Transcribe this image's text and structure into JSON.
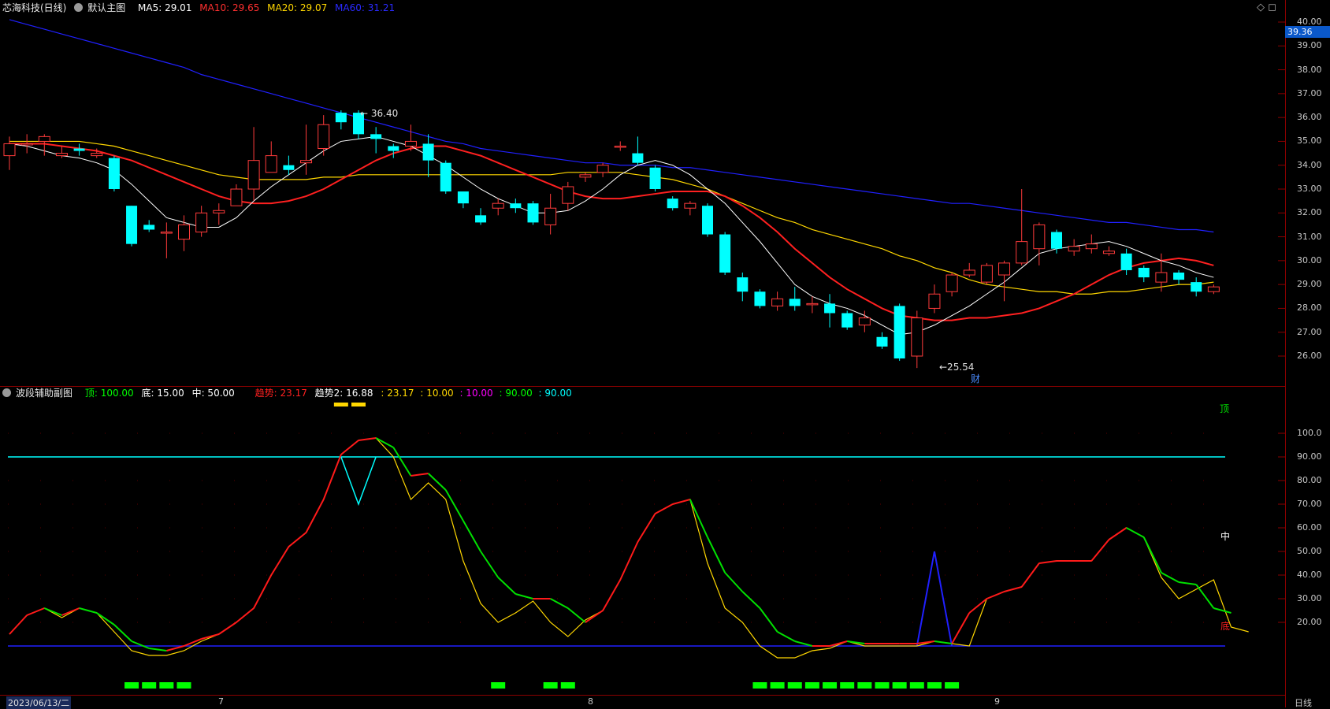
{
  "main_legend": {
    "stock_name": "芯海科技(日线)",
    "chart_name": "默认主图",
    "ma5": "MA5: 29.01",
    "ma10": "MA10: 29.65",
    "ma20": "MA20: 29.07",
    "ma60": "MA60: 31.21"
  },
  "sub_legend": {
    "chart_name": "波段辅助副图",
    "top": "顶: 100.00",
    "bottom": "底: 15.00",
    "mid": "中: 50.00",
    "trend": "趋势: 23.17",
    "trend2": "趋势2: 16.88",
    "v1": ": 23.17",
    "v2": ": 10.00",
    "v3": ": 10.00",
    "v4": ": 90.00",
    "v5": ": 90.00"
  },
  "last_price": "39.36",
  "high_label": "← 36.40",
  "low_label": "←25.54",
  "finance_marker": "财",
  "cycle_top": "顶",
  "cycle_mid": "中",
  "cycle_bottom": "底",
  "start_date": "2023/06/13/二",
  "period": "日线",
  "corner_icons": "◇ ◻",
  "x_month_labels": [
    "7",
    "8",
    "9"
  ],
  "y_ticks_main": [
    "40.00",
    "39.00",
    "38.00",
    "37.00",
    "36.00",
    "35.00",
    "34.00",
    "33.00",
    "32.00",
    "31.00",
    "30.00",
    "29.00",
    "28.00",
    "27.00",
    "26.00"
  ],
  "y_ticks_sub": [
    "100.0",
    "90.00",
    "80.00",
    "70.00",
    "60.00",
    "50.00",
    "40.00",
    "30.00",
    "20.00"
  ],
  "colors": {
    "up": "#ff3b3b",
    "down": "#00ffff",
    "ma5": "#ffffff",
    "ma10": "#ff2020",
    "ma20": "#ffd700",
    "ma60": "#2020ff",
    "signal": "#00ff00"
  },
  "chart_data": [
    {
      "type": "candlestick",
      "title": "芯海科技(日线)",
      "ylim": [
        25.5,
        40.0
      ],
      "candles": [
        [
          34.4,
          34.9,
          33.8,
          35.2
        ],
        [
          34.9,
          34.9,
          34.5,
          35.3
        ],
        [
          35.0,
          35.2,
          34.4,
          35.3
        ],
        [
          34.4,
          34.5,
          34.3,
          34.8
        ],
        [
          34.7,
          34.6,
          34.4,
          34.9
        ],
        [
          34.4,
          34.5,
          34.3,
          34.7
        ],
        [
          34.3,
          33.0,
          32.9,
          34.4
        ],
        [
          32.3,
          30.7,
          30.6,
          32.3
        ],
        [
          31.5,
          31.3,
          31.2,
          31.7
        ],
        [
          31.2,
          31.2,
          30.1,
          31.6
        ],
        [
          30.9,
          31.5,
          30.4,
          31.9
        ],
        [
          31.2,
          32.0,
          31.0,
          32.3
        ],
        [
          32.0,
          32.1,
          31.5,
          32.4
        ],
        [
          32.3,
          33.0,
          32.3,
          33.2
        ],
        [
          33.0,
          34.2,
          32.5,
          35.6
        ],
        [
          33.7,
          34.4,
          33.7,
          35.0
        ],
        [
          34.0,
          33.8,
          33.6,
          34.4
        ],
        [
          34.1,
          34.2,
          33.6,
          35.7
        ],
        [
          34.7,
          35.7,
          34.4,
          36.1
        ],
        [
          36.2,
          35.8,
          35.5,
          36.3
        ],
        [
          36.2,
          35.3,
          35.1,
          36.3
        ],
        [
          35.3,
          35.1,
          34.5,
          35.6
        ],
        [
          34.8,
          34.6,
          34.3,
          34.9
        ],
        [
          34.8,
          35.0,
          34.6,
          35.7
        ],
        [
          34.9,
          34.2,
          33.5,
          35.3
        ],
        [
          34.1,
          32.9,
          32.8,
          34.2
        ],
        [
          32.9,
          32.4,
          32.2,
          32.9
        ],
        [
          31.9,
          31.6,
          31.5,
          32.2
        ],
        [
          32.2,
          32.4,
          31.9,
          32.6
        ],
        [
          32.4,
          32.2,
          32.0,
          32.6
        ],
        [
          32.4,
          31.6,
          31.5,
          32.5
        ],
        [
          31.5,
          32.2,
          31.1,
          32.8
        ],
        [
          32.4,
          33.1,
          32.1,
          33.3
        ],
        [
          33.5,
          33.6,
          33.3,
          33.7
        ],
        [
          33.7,
          34.0,
          33.5,
          34.1
        ],
        [
          34.8,
          34.8,
          34.6,
          35.0
        ],
        [
          34.5,
          34.1,
          34.0,
          35.2
        ],
        [
          33.9,
          33.0,
          32.9,
          34.0
        ],
        [
          32.6,
          32.2,
          32.1,
          32.7
        ],
        [
          32.2,
          32.4,
          31.9,
          32.5
        ],
        [
          32.3,
          31.1,
          31.0,
          32.4
        ],
        [
          31.1,
          29.5,
          29.4,
          31.2
        ],
        [
          29.3,
          28.7,
          28.3,
          29.5
        ],
        [
          28.7,
          28.1,
          28.0,
          28.8
        ],
        [
          28.1,
          28.4,
          27.9,
          28.7
        ],
        [
          28.4,
          28.1,
          27.9,
          28.9
        ],
        [
          28.2,
          28.2,
          27.8,
          28.5
        ],
        [
          28.2,
          27.8,
          27.2,
          28.6
        ],
        [
          27.8,
          27.2,
          27.1,
          27.9
        ],
        [
          27.3,
          27.6,
          27.0,
          27.9
        ],
        [
          26.8,
          26.4,
          26.3,
          27.0
        ],
        [
          28.1,
          25.9,
          25.8,
          28.2
        ],
        [
          26.0,
          27.6,
          25.5,
          27.9
        ],
        [
          28.0,
          28.6,
          27.8,
          29.0
        ],
        [
          28.7,
          29.4,
          28.5,
          29.5
        ],
        [
          29.4,
          29.6,
          29.3,
          29.9
        ],
        [
          29.1,
          29.8,
          29.0,
          29.9
        ],
        [
          29.4,
          29.9,
          28.3,
          30.0
        ],
        [
          29.9,
          30.8,
          29.8,
          33.0
        ],
        [
          30.5,
          31.5,
          29.8,
          31.6
        ],
        [
          31.2,
          30.5,
          30.3,
          31.3
        ],
        [
          30.4,
          30.6,
          30.2,
          30.9
        ],
        [
          30.5,
          30.7,
          30.3,
          31.1
        ],
        [
          30.3,
          30.4,
          30.2,
          30.6
        ],
        [
          30.3,
          29.6,
          29.4,
          30.5
        ],
        [
          29.7,
          29.3,
          29.1,
          29.8
        ],
        [
          29.1,
          29.5,
          28.7,
          30.3
        ],
        [
          29.5,
          29.2,
          29.0,
          29.6
        ],
        [
          29.1,
          28.7,
          28.5,
          29.3
        ],
        [
          28.7,
          28.9,
          28.6,
          29.0
        ]
      ],
      "ma5": [
        34.9,
        34.8,
        34.6,
        34.4,
        34.3,
        34.1,
        33.8,
        33.2,
        32.5,
        31.8,
        31.6,
        31.4,
        31.4,
        31.8,
        32.5,
        33.1,
        33.6,
        34.1,
        34.6,
        35.0,
        35.1,
        35.2,
        35.0,
        34.8,
        34.4,
        34.0,
        33.5,
        33.0,
        32.6,
        32.3,
        32.0,
        32.0,
        32.1,
        32.5,
        33.0,
        33.6,
        34.0,
        34.2,
        34.0,
        33.6,
        33.0,
        32.4,
        31.6,
        30.8,
        29.9,
        29.0,
        28.5,
        28.2,
        28.0,
        27.7,
        27.3,
        26.9,
        27.0,
        27.3,
        27.7,
        28.1,
        28.6,
        29.1,
        29.7,
        30.3,
        30.5,
        30.6,
        30.7,
        30.8,
        30.6,
        30.3,
        30.0,
        29.8,
        29.5,
        29.3
      ],
      "ma10": [
        34.9,
        34.9,
        34.9,
        34.8,
        34.7,
        34.6,
        34.4,
        34.2,
        33.9,
        33.6,
        33.3,
        33.0,
        32.7,
        32.5,
        32.4,
        32.4,
        32.5,
        32.7,
        33.0,
        33.4,
        33.8,
        34.2,
        34.5,
        34.7,
        34.8,
        34.8,
        34.6,
        34.4,
        34.1,
        33.8,
        33.5,
        33.2,
        32.9,
        32.7,
        32.6,
        32.6,
        32.7,
        32.8,
        32.9,
        32.9,
        32.9,
        32.7,
        32.3,
        31.8,
        31.2,
        30.5,
        29.9,
        29.3,
        28.8,
        28.4,
        28.0,
        27.7,
        27.6,
        27.5,
        27.5,
        27.6,
        27.6,
        27.7,
        27.8,
        28.0,
        28.3,
        28.6,
        29.0,
        29.4,
        29.7,
        29.9,
        30.0,
        30.1,
        30.0,
        29.8
      ],
      "ma20": [
        35.0,
        35.0,
        35.0,
        35.0,
        35.0,
        34.9,
        34.8,
        34.6,
        34.4,
        34.2,
        34.0,
        33.8,
        33.6,
        33.5,
        33.4,
        33.4,
        33.4,
        33.4,
        33.5,
        33.5,
        33.6,
        33.6,
        33.6,
        33.6,
        33.6,
        33.6,
        33.6,
        33.6,
        33.6,
        33.6,
        33.6,
        33.6,
        33.7,
        33.7,
        33.7,
        33.7,
        33.6,
        33.5,
        33.4,
        33.2,
        33.0,
        32.7,
        32.4,
        32.1,
        31.8,
        31.6,
        31.3,
        31.1,
        30.9,
        30.7,
        30.5,
        30.2,
        30.0,
        29.7,
        29.5,
        29.2,
        29.0,
        28.9,
        28.8,
        28.7,
        28.7,
        28.6,
        28.6,
        28.7,
        28.7,
        28.8,
        28.9,
        29.0,
        29.0,
        29.1
      ],
      "ma60": [
        40.1,
        39.9,
        39.7,
        39.5,
        39.3,
        39.1,
        38.9,
        38.7,
        38.5,
        38.3,
        38.1,
        37.8,
        37.6,
        37.4,
        37.2,
        37.0,
        36.8,
        36.6,
        36.4,
        36.2,
        36.0,
        35.8,
        35.6,
        35.4,
        35.2,
        35.0,
        34.9,
        34.7,
        34.6,
        34.5,
        34.4,
        34.3,
        34.2,
        34.1,
        34.1,
        34.0,
        34.0,
        34.0,
        33.9,
        33.9,
        33.8,
        33.7,
        33.6,
        33.5,
        33.4,
        33.3,
        33.2,
        33.1,
        33.0,
        32.9,
        32.8,
        32.7,
        32.6,
        32.5,
        32.4,
        32.4,
        32.3,
        32.2,
        32.1,
        32.0,
        31.9,
        31.8,
        31.7,
        31.6,
        31.6,
        31.5,
        31.4,
        31.3,
        31.3,
        31.2
      ]
    },
    {
      "type": "line",
      "title": "波段辅助副图",
      "ylim": [
        0,
        100
      ],
      "reference_lines": [
        90,
        10
      ],
      "trend": [
        15,
        23,
        26,
        23,
        26,
        24,
        19,
        12,
        9,
        8,
        10,
        13,
        15,
        20,
        26,
        40,
        52,
        58,
        72,
        91,
        97,
        98,
        94,
        82,
        83,
        76,
        63,
        50,
        39,
        32,
        30,
        30,
        26,
        20,
        25,
        38,
        54,
        66,
        70,
        72,
        56,
        41,
        33,
        26,
        16,
        12,
        10,
        10,
        12,
        11,
        11,
        11,
        11,
        12,
        11,
        24,
        30,
        33,
        35,
        45,
        46,
        46,
        46,
        55,
        60,
        56,
        41,
        37,
        36,
        26,
        24
      ],
      "trend2": [
        15,
        23,
        26,
        22,
        26,
        24,
        16,
        8,
        6,
        6,
        8,
        12,
        15,
        20,
        26,
        40,
        52,
        58,
        72,
        91,
        97,
        98,
        90,
        72,
        79,
        72,
        46,
        28,
        20,
        24,
        29,
        20,
        14,
        21,
        25,
        38,
        54,
        66,
        70,
        72,
        45,
        26,
        20,
        10,
        5,
        5,
        8,
        9,
        12,
        10,
        10,
        10,
        10,
        12,
        11,
        10,
        30,
        33,
        35,
        45,
        46,
        46,
        46,
        55,
        60,
        56,
        39,
        30,
        34,
        38,
        18,
        16
      ],
      "blue_spike": {
        "x_index": 53,
        "value": 50
      },
      "signal_bars": [
        7,
        8,
        9,
        10,
        28,
        31,
        32,
        43,
        44,
        45,
        46,
        47,
        48,
        49,
        50,
        51,
        52,
        53,
        54
      ]
    }
  ]
}
